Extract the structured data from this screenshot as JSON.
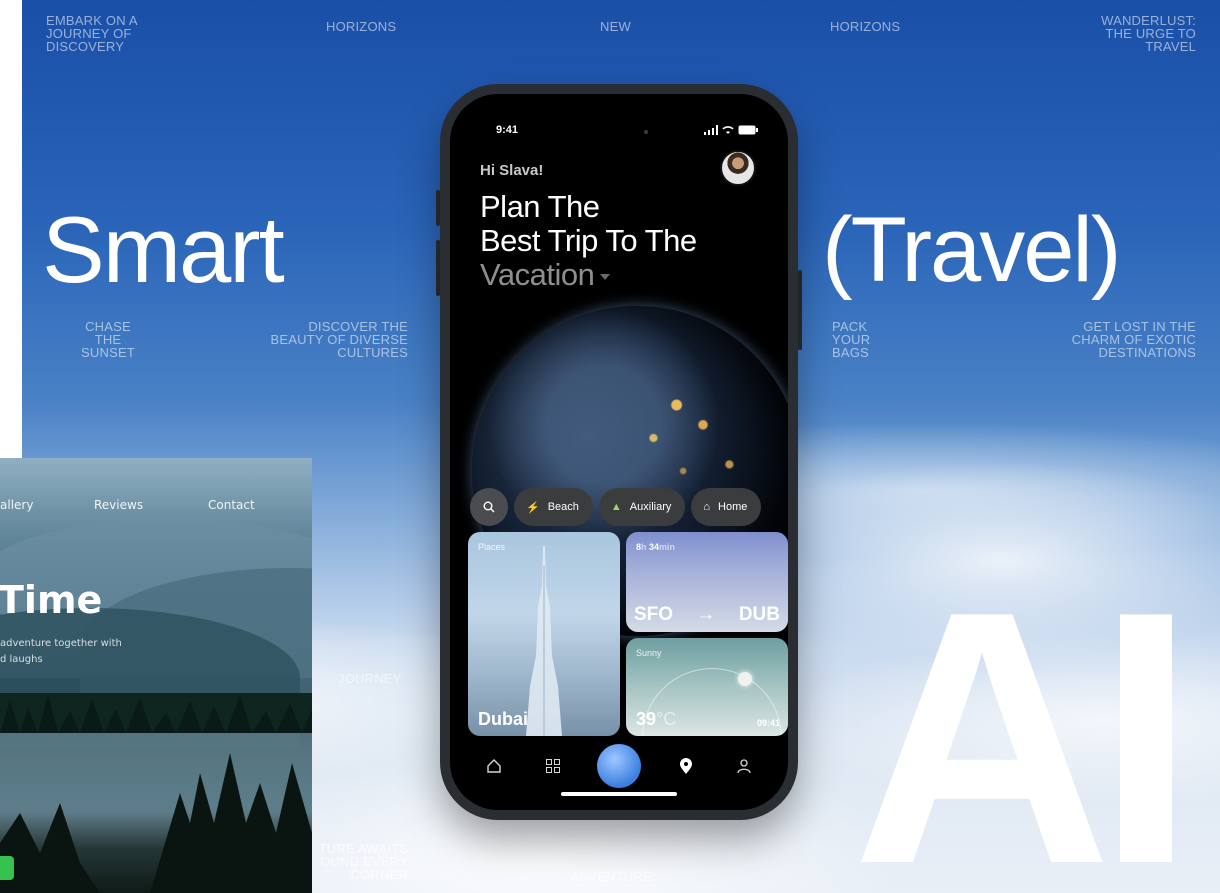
{
  "poster": {
    "top_left": "EMBARK ON A\nJOURNEY OF\nDISCOVERY",
    "top_h1": "HORIZONS",
    "top_new": "NEW",
    "top_h2": "HORIZONS",
    "top_right": "WANDERLUST:\nTHE URGE TO\nTRAVEL",
    "smart": "Smart",
    "travel": "(Travel)",
    "chase": "CHASE\nTHE\nSUNSET",
    "discover": "DISCOVER THE\nBEAUTY OF DIVERSE\nCULTURES",
    "pack": "PACK\nYOUR\nBAGS",
    "lost": "GET LOST IN THE\nCHARM OF EXOTIC\nDESTINATIONS",
    "journey": "JOURNEY",
    "awaits": "TURE AWAITS\nOUND EVERY\nCORNER",
    "adventure": "ADVENTURE",
    "ai": "AI"
  },
  "site": {
    "nav": [
      "allery",
      "Reviews",
      "Contact"
    ],
    "headline": "Time",
    "sub": "adventure together with\nd laughs"
  },
  "phone": {
    "time": "9:41",
    "greeting": "Hi Slava!",
    "title_line1": "Plan The",
    "title_line2": "Best Trip To The",
    "title_line3": "Vacation",
    "chips": [
      {
        "icon": "beach-icon",
        "label": "Beach"
      },
      {
        "icon": "auxiliary-icon",
        "label": "Auxiliary"
      },
      {
        "icon": "home-icon",
        "label": "Home"
      }
    ],
    "places": {
      "label": "Places",
      "city": "Dubai"
    },
    "flight": {
      "hours": "8",
      "h": "h",
      "mins": "34",
      "min": "min",
      "from": "SFO",
      "arrow": "→",
      "to": "DUB"
    },
    "weather": {
      "label": "Sunny",
      "temp": "39",
      "unit": "°C",
      "time": "09:41"
    }
  }
}
